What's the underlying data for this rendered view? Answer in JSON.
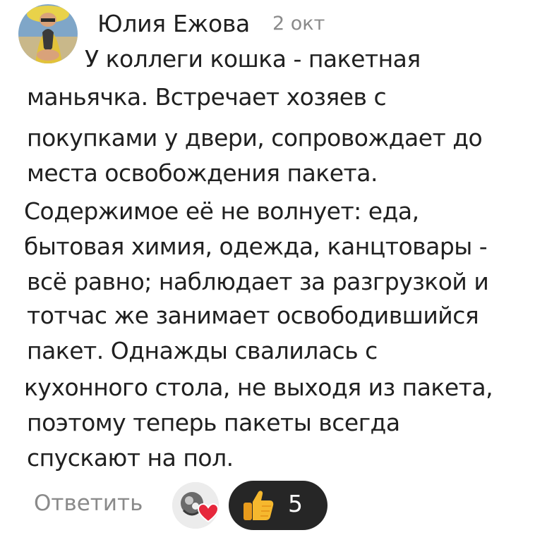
{
  "comment": {
    "author": "Юлия Ежова",
    "timestamp": "2 окт",
    "lines": [
      "У коллеги кошка - пакетная",
      "маньячка. Встречает хозяев с",
      "покупками у двери, сопровождает до",
      "места освобождения пакета.",
      "Содержимое её не волнует: еда,",
      "бытовая химия, одежда, канцтовары -",
      "всё равно; наблюдает за разгрузкой и",
      "тотчас же  занимает освободившийся",
      "пакет. Однажды свалилась с",
      "кухонного стола, не выходя из пакета,",
      "поэтому  теперь пакеты всегда",
      "спускают на пол."
    ]
  },
  "actions": {
    "reply_label": "Ответить",
    "reaction_count": "5",
    "reaction_icon": "thumbs-up-icon",
    "reactor_reaction_icon": "heart-icon"
  },
  "colors": {
    "text": "#202020",
    "muted": "#8a8a8a",
    "pill": "#262626",
    "heart": "#e6283c",
    "thumb": "#f5b82e"
  }
}
